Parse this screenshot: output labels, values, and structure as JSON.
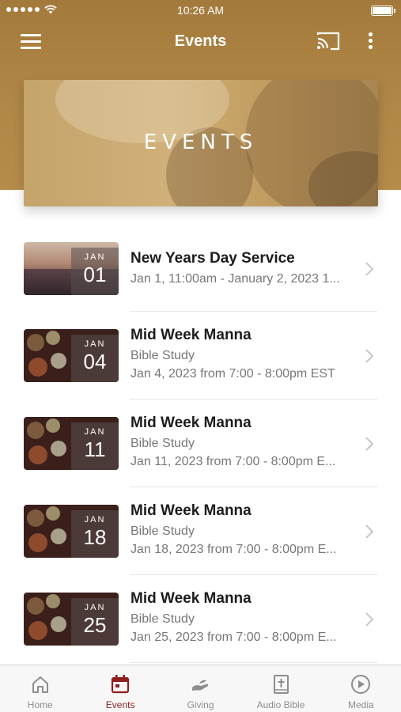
{
  "status_bar": {
    "time": "10:26 AM"
  },
  "nav": {
    "title": "Events"
  },
  "banner": {
    "title": "EVENTS"
  },
  "events": [
    {
      "title": "New Years Day Service",
      "subtitle": "",
      "date_text": "Jan 1, 11:00am - January 2, 2023 1...",
      "month": "JAN",
      "day": "01",
      "thumb": "sunset"
    },
    {
      "title": "Mid Week Manna",
      "subtitle": "Bible Study",
      "date_text": "Jan 4, 2023 from 7:00 - 8:00pm EST",
      "month": "JAN",
      "day": "04",
      "thumb": "food"
    },
    {
      "title": "Mid Week Manna",
      "subtitle": "Bible Study",
      "date_text": "Jan 11, 2023 from 7:00 - 8:00pm E...",
      "month": "JAN",
      "day": "11",
      "thumb": "food"
    },
    {
      "title": "Mid Week Manna",
      "subtitle": "Bible Study",
      "date_text": "Jan 18, 2023 from 7:00 - 8:00pm E...",
      "month": "JAN",
      "day": "18",
      "thumb": "food"
    },
    {
      "title": "Mid Week Manna",
      "subtitle": "Bible Study",
      "date_text": "Jan 25, 2023 from 7:00 - 8:00pm E...",
      "month": "JAN",
      "day": "25",
      "thumb": "food"
    }
  ],
  "tabs": [
    {
      "label": "Home",
      "icon": "home-icon",
      "active": false
    },
    {
      "label": "Events",
      "icon": "calendar-icon",
      "active": true
    },
    {
      "label": "Giving",
      "icon": "giving-hand-icon",
      "active": false
    },
    {
      "label": "Audio Bible",
      "icon": "bible-icon",
      "active": false
    },
    {
      "label": "Media",
      "icon": "play-circle-icon",
      "active": false
    }
  ],
  "colors": {
    "header_bg": "#b08746",
    "active_tab": "#8f1f1f",
    "inactive_tab": "#8e8e8e"
  }
}
